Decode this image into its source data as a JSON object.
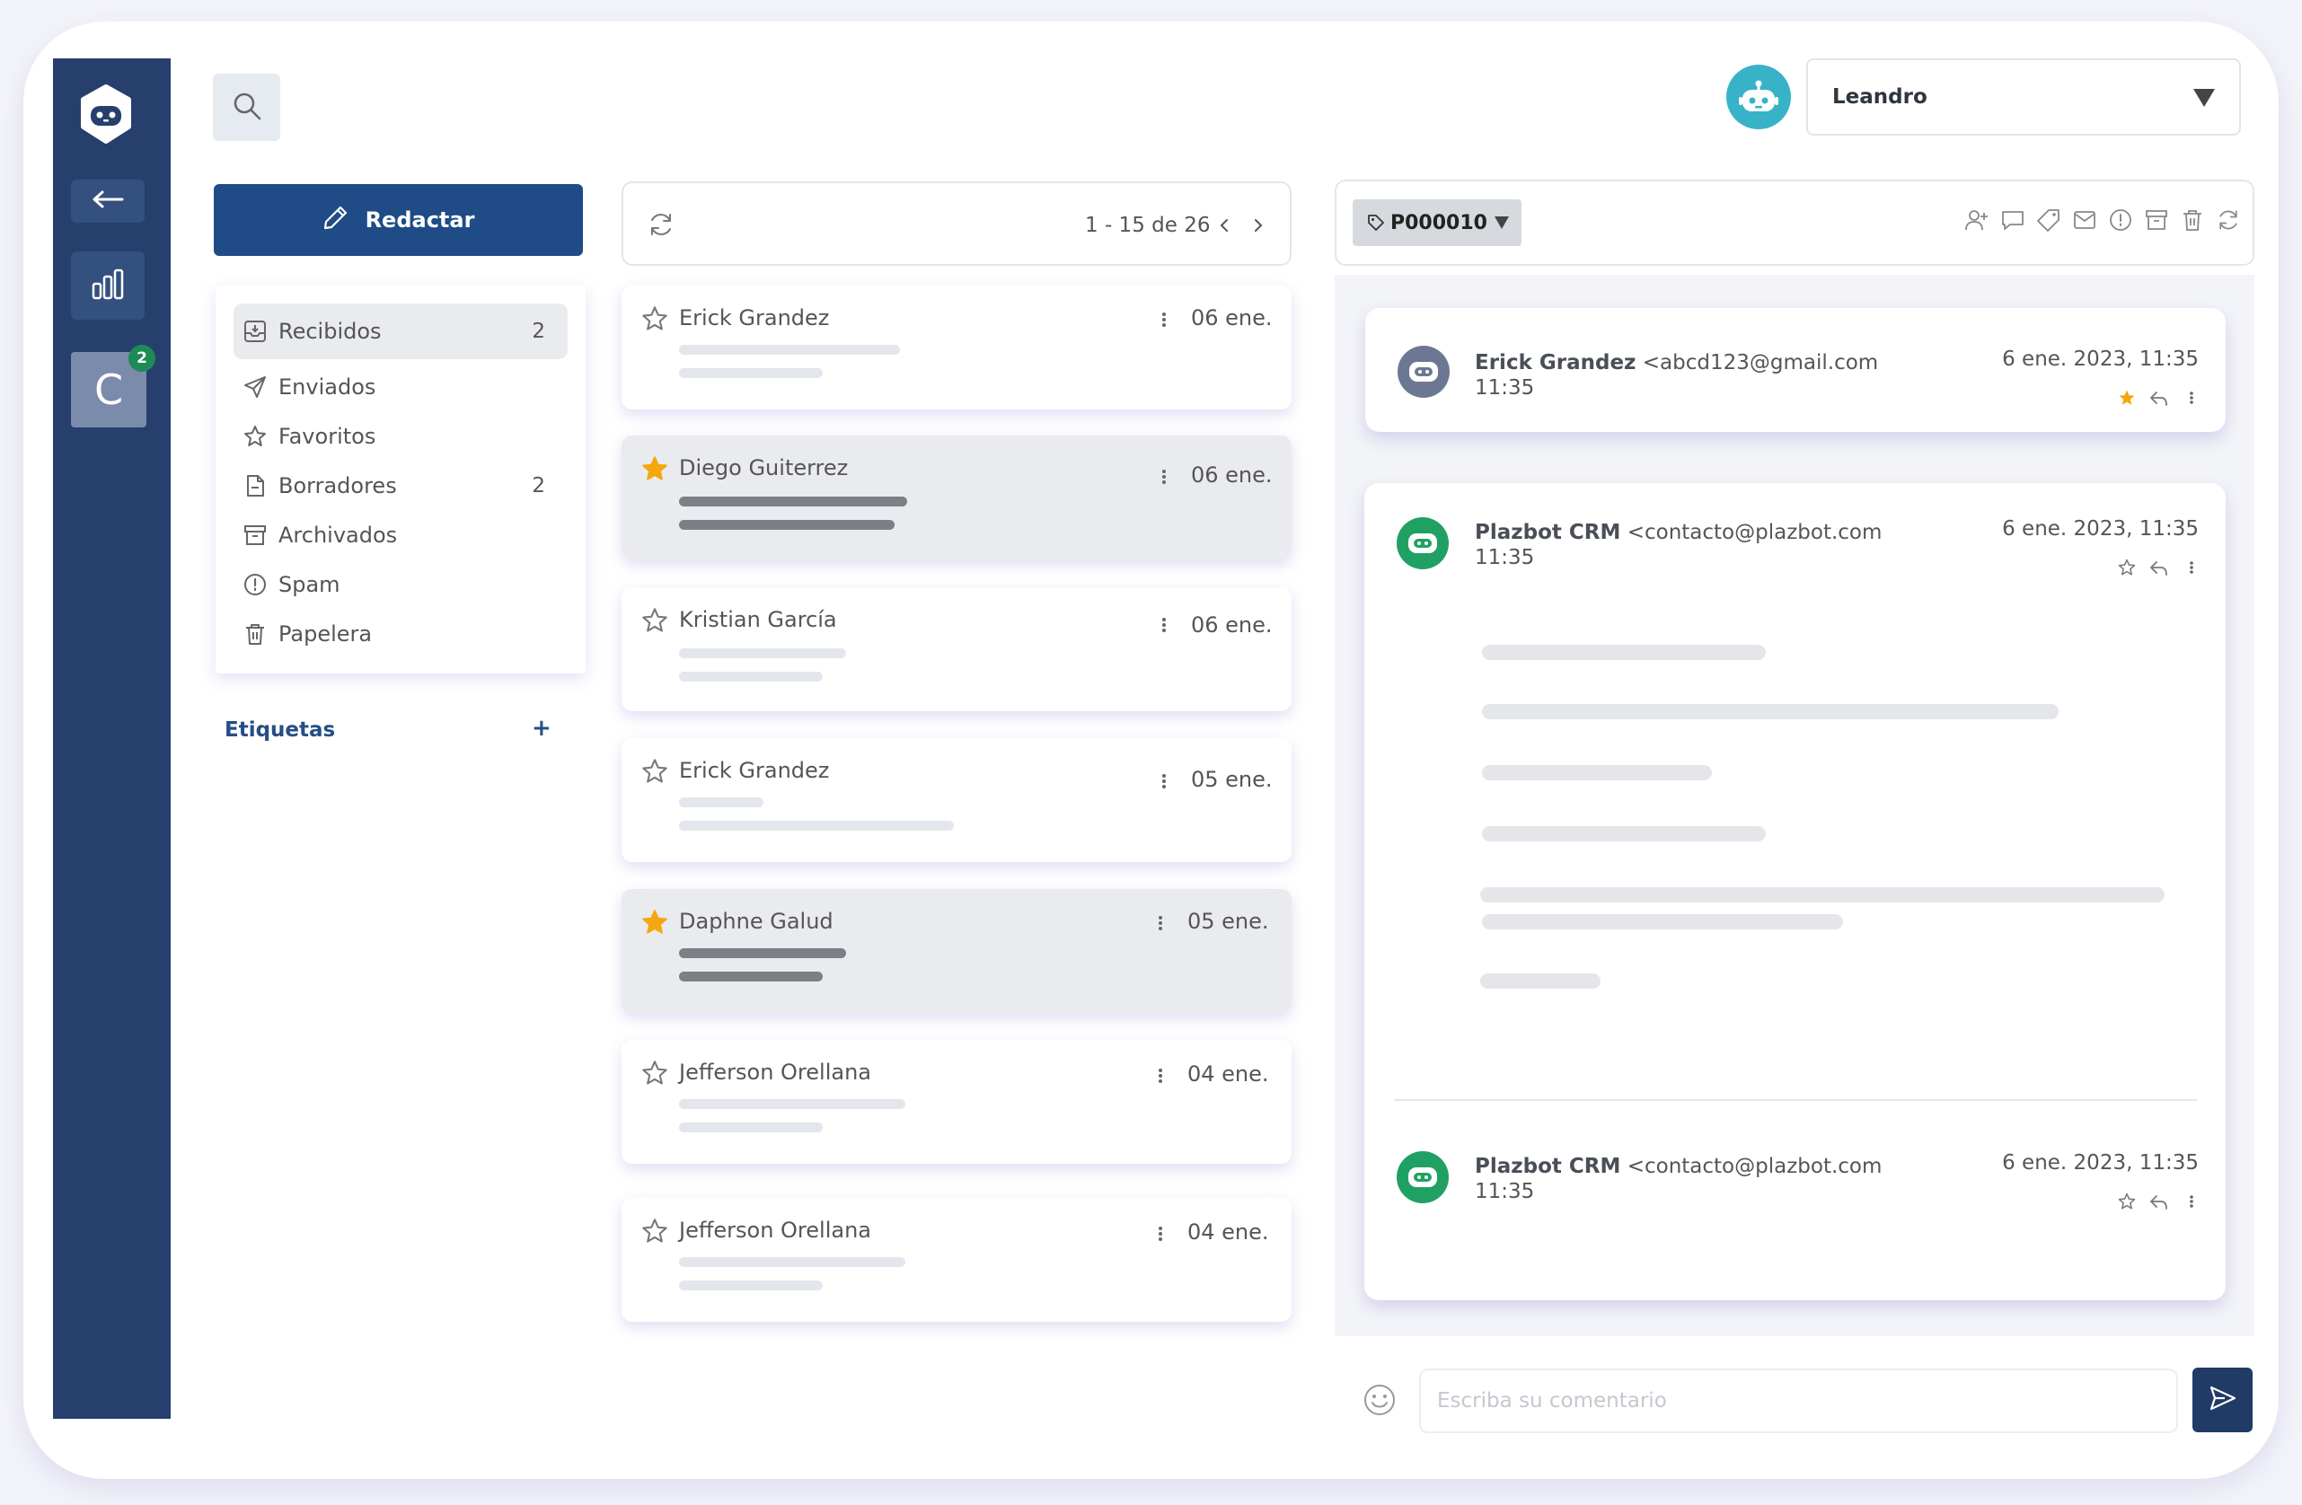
{
  "colors": {
    "rail": "#263f6d",
    "primary": "#1f4b86",
    "star_active": "#f4a70e",
    "badge": "#1e8a55",
    "bot_green": "#20a163",
    "bot_cyan": "#38b2c7"
  },
  "rail": {
    "logo_icon": "bot-logo-icon",
    "back_icon": "arrow-left-icon",
    "stats_icon": "bar-chart-icon",
    "channel_letter": "C",
    "channel_badge": "2"
  },
  "header": {
    "search_icon": "search-icon",
    "user_name": "Leandro"
  },
  "compose": {
    "label": "Redactar",
    "icon": "pencil-icon"
  },
  "folders": [
    {
      "label": "Recibidos",
      "icon": "inbox-icon",
      "count": "2"
    },
    {
      "label": "Enviados",
      "icon": "send-icon",
      "count": ""
    },
    {
      "label": "Favoritos",
      "icon": "star-icon",
      "count": ""
    },
    {
      "label": "Borradores",
      "icon": "draft-icon",
      "count": "2"
    },
    {
      "label": "Archivados",
      "icon": "archive-icon",
      "count": ""
    },
    {
      "label": "Spam",
      "icon": "alert-icon",
      "count": ""
    },
    {
      "label": "Papelera",
      "icon": "trash-icon",
      "count": ""
    }
  ],
  "labels_section": {
    "title": "Etiquetas",
    "add": "+"
  },
  "list": {
    "pagination": "1 - 15 de 26",
    "items": [
      {
        "sender": "Erick Grandez",
        "date": "06 ene.",
        "starred": false,
        "selected": false
      },
      {
        "sender": "Diego Guiterrez",
        "date": "06 ene.",
        "starred": true,
        "selected": true
      },
      {
        "sender": "Kristian García",
        "date": "06 ene.",
        "starred": false,
        "selected": false
      },
      {
        "sender": "Erick Grandez",
        "date": "05 ene.",
        "starred": false,
        "selected": false
      },
      {
        "sender": "Daphne Galud",
        "date": "05 ene.",
        "starred": true,
        "selected": true
      },
      {
        "sender": "Jefferson Orellana",
        "date": "04 ene.",
        "starred": false,
        "selected": false
      },
      {
        "sender": "Jefferson Orellana",
        "date": "04 ene.",
        "starred": false,
        "selected": false
      }
    ]
  },
  "detail": {
    "ticket_tag": "P000010",
    "toolbar_icons": [
      "assign-user-icon",
      "comment-icon",
      "tag-icon",
      "mail-icon",
      "alert-icon",
      "archive-icon",
      "trash-icon",
      "refresh-icon"
    ],
    "messages": [
      {
        "name": "Erick Grandez",
        "email": "<abcd123@gmail.com",
        "time": "11:35",
        "date": "6 ene. 2023, 11:35",
        "starred": true
      },
      {
        "name": "Plazbot CRM",
        "email": "<contacto@plazbot.com",
        "time": "11:35",
        "date": "6 ene. 2023, 11:35",
        "starred": false
      },
      {
        "name": "Plazbot CRM",
        "email": "<contacto@plazbot.com",
        "time": "11:35",
        "date": "6 ene. 2023, 11:35",
        "starred": false
      }
    ]
  },
  "comment": {
    "placeholder": "Escriba su comentario",
    "emoji_icon": "smiley-icon",
    "send_icon": "paper-plane-icon"
  }
}
